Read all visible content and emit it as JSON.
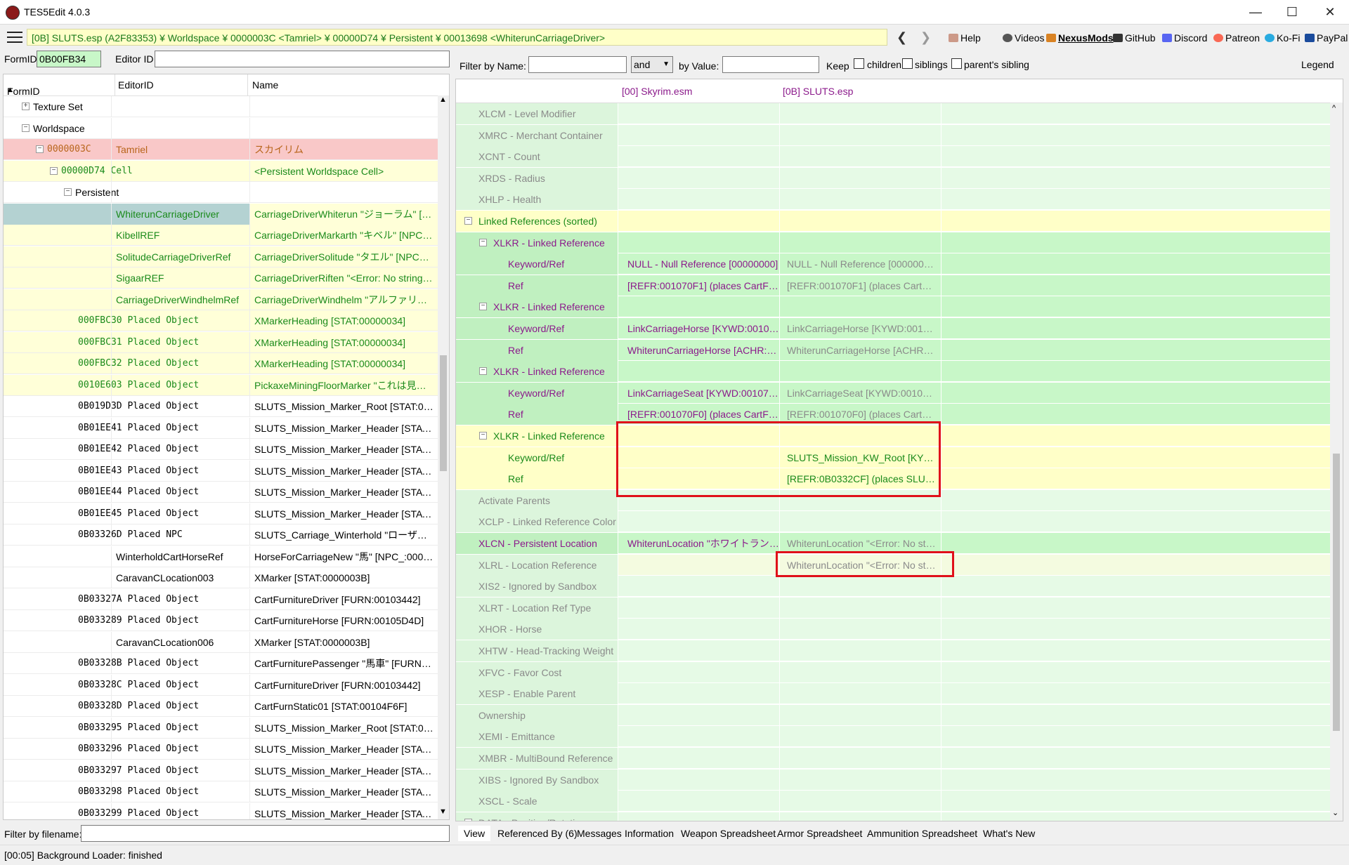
{
  "window": {
    "title": "TES5Edit 4.0.3"
  },
  "toolbar": {
    "path": "[0B] SLUTS.esp (A2F83353) ¥ Worldspace ¥ 0000003C <Tamriel> ¥ 00000D74 ¥ Persistent ¥ 00013698 <WhiterunCarriageDriver>",
    "links": [
      "Help",
      "Videos",
      "NexusMods",
      "GitHub",
      "Discord",
      "Patreon",
      "Ko-Fi",
      "PayPal"
    ]
  },
  "left": {
    "formid_label": "FormID",
    "formid_value": "0B00FB34",
    "editorid_label": "Editor ID",
    "editorid_value": "",
    "columns": [
      "FormID",
      "EditorID",
      "Name"
    ],
    "rows": [
      {
        "indent": 0,
        "toggle": "+",
        "c1": "Texture Set",
        "c2": "",
        "c3": "",
        "style": "plain"
      },
      {
        "indent": 0,
        "toggle": "-",
        "c1": "Worldspace",
        "c2": "",
        "c3": "",
        "style": "plain"
      },
      {
        "indent": 1,
        "toggle": "-",
        "c1": "0000003C",
        "c2": "Tamriel",
        "c3": "スカイリム",
        "style": "pink"
      },
      {
        "indent": 2,
        "toggle": "-",
        "c1": "00000D74  Cell",
        "c2": "",
        "c3": "<Persistent Worldspace Cell>",
        "style": "yellowgreen"
      },
      {
        "indent": 3,
        "toggle": "-",
        "c1": "Persistent",
        "c2": "",
        "c3": "",
        "style": "plain"
      },
      {
        "indent": 4,
        "toggle": "",
        "c1": "",
        "c2": "WhiterunCarriageDriver",
        "c3": "CarriageDriverWhiterun \"ジョーラム\" [NPC_...",
        "style": "selected"
      },
      {
        "indent": 4,
        "toggle": "",
        "c1": "",
        "c2": "KibellREF",
        "c3": "CarriageDriverMarkarth \"キベル\" [NPC_:00...",
        "style": "yg"
      },
      {
        "indent": 4,
        "toggle": "",
        "c1": "",
        "c2": "SolitudeCarriageDriverRef",
        "c3": "CarriageDriverSolitude \"タエル\" [NPC_:00...",
        "style": "yg"
      },
      {
        "indent": 4,
        "toggle": "",
        "c1": "",
        "c2": "SigaarREF",
        "c3": "CarriageDriverRiften \"<Error: No strings ...",
        "style": "yg"
      },
      {
        "indent": 4,
        "toggle": "",
        "c1": "",
        "c2": "CarriageDriverWindhelmRef",
        "c3": "CarriageDriverWindhelm \"アルファリン\" [N...",
        "style": "yg"
      },
      {
        "indent": 4,
        "toggle": "",
        "c1": "000FBC30  Placed Object",
        "c2": "",
        "c3": "XMarkerHeading [STAT:00000034]",
        "style": "yg"
      },
      {
        "indent": 4,
        "toggle": "",
        "c1": "000FBC31  Placed Object",
        "c2": "",
        "c3": "XMarkerHeading [STAT:00000034]",
        "style": "yg"
      },
      {
        "indent": 4,
        "toggle": "",
        "c1": "000FBC32  Placed Object",
        "c2": "",
        "c3": "XMarkerHeading [STAT:00000034]",
        "style": "yg"
      },
      {
        "indent": 4,
        "toggle": "",
        "c1": "0010E603  Placed Object",
        "c2": "",
        "c3": "PickaxeMiningFloorMarker \"これは見えて...",
        "style": "yg"
      },
      {
        "indent": 4,
        "toggle": "",
        "c1": "0B019D3D  Placed Object",
        "c2": "",
        "c3": "SLUTS_Mission_Marker_Root [STAT:0B01...",
        "style": "plain"
      },
      {
        "indent": 4,
        "toggle": "",
        "c1": "0B01EE41  Placed Object",
        "c2": "",
        "c3": "SLUTS_Mission_Marker_Header [STAT:0B...",
        "style": "plain"
      },
      {
        "indent": 4,
        "toggle": "",
        "c1": "0B01EE42  Placed Object",
        "c2": "",
        "c3": "SLUTS_Mission_Marker_Header [STAT:0B...",
        "style": "plain"
      },
      {
        "indent": 4,
        "toggle": "",
        "c1": "0B01EE43  Placed Object",
        "c2": "",
        "c3": "SLUTS_Mission_Marker_Header [STAT:0B...",
        "style": "plain"
      },
      {
        "indent": 4,
        "toggle": "",
        "c1": "0B01EE44  Placed Object",
        "c2": "",
        "c3": "SLUTS_Mission_Marker_Header [STAT:0B...",
        "style": "plain"
      },
      {
        "indent": 4,
        "toggle": "",
        "c1": "0B01EE45  Placed Object",
        "c2": "",
        "c3": "SLUTS_Mission_Marker_Header [STAT:0B...",
        "style": "plain"
      },
      {
        "indent": 4,
        "toggle": "",
        "c1": "0B03326D  Placed NPC",
        "c2": "",
        "c3": "SLUTS_Carriage_Winterhold \"ローザー・スノ...",
        "style": "plain"
      },
      {
        "indent": 4,
        "toggle": "",
        "c1": "",
        "c2": "WinterholdCartHorseRef",
        "c3": "HorseForCarriageNew \"馬\" [NPC_:00072...",
        "style": "plain"
      },
      {
        "indent": 4,
        "toggle": "",
        "c1": "",
        "c2": "CaravanCLocation003",
        "c3": "XMarker [STAT:0000003B]",
        "style": "plain"
      },
      {
        "indent": 4,
        "toggle": "",
        "c1": "0B03327A  Placed Object",
        "c2": "",
        "c3": "CartFurnitureDriver [FURN:00103442]",
        "style": "plain"
      },
      {
        "indent": 4,
        "toggle": "",
        "c1": "0B033289  Placed Object",
        "c2": "",
        "c3": "CartFurnitureHorse [FURN:00105D4D]",
        "style": "plain"
      },
      {
        "indent": 4,
        "toggle": "",
        "c1": "",
        "c2": "CaravanCLocation006",
        "c3": "XMarker [STAT:0000003B]",
        "style": "plain"
      },
      {
        "indent": 4,
        "toggle": "",
        "c1": "0B03328B  Placed Object",
        "c2": "",
        "c3": "CartFurniturePassenger \"馬車\" [FURN:00...",
        "style": "plain"
      },
      {
        "indent": 4,
        "toggle": "",
        "c1": "0B03328C  Placed Object",
        "c2": "",
        "c3": "CartFurnitureDriver [FURN:00103442]",
        "style": "plain"
      },
      {
        "indent": 4,
        "toggle": "",
        "c1": "0B03328D  Placed Object",
        "c2": "",
        "c3": "CartFurnStatic01 [STAT:00104F6F]",
        "style": "plain"
      },
      {
        "indent": 4,
        "toggle": "",
        "c1": "0B033295  Placed Object",
        "c2": "",
        "c3": "SLUTS_Mission_Marker_Root [STAT:0B01...",
        "style": "plain"
      },
      {
        "indent": 4,
        "toggle": "",
        "c1": "0B033296  Placed Object",
        "c2": "",
        "c3": "SLUTS_Mission_Marker_Header [STAT:0B...",
        "style": "plain"
      },
      {
        "indent": 4,
        "toggle": "",
        "c1": "0B033297  Placed Object",
        "c2": "",
        "c3": "SLUTS_Mission_Marker_Header [STAT:0B...",
        "style": "plain"
      },
      {
        "indent": 4,
        "toggle": "",
        "c1": "0B033298  Placed Object",
        "c2": "",
        "c3": "SLUTS_Mission_Marker_Header [STAT:0B...",
        "style": "plain"
      },
      {
        "indent": 4,
        "toggle": "",
        "c1": "0B033299  Placed Object",
        "c2": "",
        "c3": "SLUTS_Mission_Marker_Header [STAT:0B...",
        "style": "plain"
      }
    ],
    "filter_label": "Filter by filename:",
    "filter_value": ""
  },
  "right": {
    "filter_name_label": "Filter by Name:",
    "filter_name_value": "",
    "op_value": "and",
    "filter_value_label": "by Value:",
    "filter_value_value": "",
    "keep_label": "Keep",
    "keep_children": "children",
    "keep_siblings": "siblings",
    "keep_parents_sibling": "parent's sibling",
    "legend": "Legend",
    "col1": "[00] Skyrim.esm",
    "col2": "[0B] SLUTS.esp",
    "rows": [
      {
        "level": 0,
        "toggle": "",
        "label": "XLCM - Level Modifier",
        "v1": "",
        "v2": "",
        "style": "dim"
      },
      {
        "level": 0,
        "toggle": "",
        "label": "XMRC - Merchant Container",
        "v1": "",
        "v2": "",
        "style": "dim"
      },
      {
        "level": 0,
        "toggle": "",
        "label": "XCNT - Count",
        "v1": "",
        "v2": "",
        "style": "dim"
      },
      {
        "level": 0,
        "toggle": "",
        "label": "XRDS - Radius",
        "v1": "",
        "v2": "",
        "style": "dim"
      },
      {
        "level": 0,
        "toggle": "",
        "label": "XHLP - Health",
        "v1": "",
        "v2": "",
        "style": "dim"
      },
      {
        "level": 0,
        "toggle": "-",
        "label": "Linked References (sorted)",
        "v1": "",
        "v2": "",
        "style": "yellow"
      },
      {
        "level": 1,
        "toggle": "-",
        "label": "XLKR - Linked Reference",
        "v1": "",
        "v2": "",
        "style": "green"
      },
      {
        "level": 2,
        "toggle": "",
        "label": "Keyword/Ref",
        "v1": "NULL - Null Reference [00000000]",
        "v2": "NULL - Null Reference [00000000]",
        "style": "green"
      },
      {
        "level": 2,
        "toggle": "",
        "label": "Ref",
        "v1": "[REFR:001070F1] (places CartFurn...",
        "v2": "[REFR:001070F1] (places CartFurn...",
        "style": "green"
      },
      {
        "level": 1,
        "toggle": "-",
        "label": "XLKR - Linked Reference",
        "v1": "",
        "v2": "",
        "style": "green"
      },
      {
        "level": 2,
        "toggle": "",
        "label": "Keyword/Ref",
        "v1": "LinkCarriageHorse [KYWD:00107...",
        "v2": "LinkCarriageHorse [KYWD:00107...",
        "style": "green"
      },
      {
        "level": 2,
        "toggle": "",
        "label": "Ref",
        "v1": "WhiterunCarriageHorse [ACHR:00...",
        "v2": "WhiterunCarriageHorse [ACHR:00...",
        "style": "green"
      },
      {
        "level": 1,
        "toggle": "-",
        "label": "XLKR - Linked Reference",
        "v1": "",
        "v2": "",
        "style": "green"
      },
      {
        "level": 2,
        "toggle": "",
        "label": "Keyword/Ref",
        "v1": "LinkCarriageSeat [KYWD:0010770...",
        "v2": "LinkCarriageSeat [KYWD:0010770...",
        "style": "green"
      },
      {
        "level": 2,
        "toggle": "",
        "label": "Ref",
        "v1": "[REFR:001070F0] (places CartFurn...",
        "v2": "[REFR:001070F0] (places CartFurn...",
        "style": "green"
      },
      {
        "level": 1,
        "toggle": "-",
        "label": "XLKR - Linked Reference",
        "v1": "",
        "v2": "",
        "style": "yellow"
      },
      {
        "level": 2,
        "toggle": "",
        "label": "Keyword/Ref",
        "v1": "",
        "v2": "SLUTS_Mission_KW_Root [KYWD:...",
        "style": "yellow"
      },
      {
        "level": 2,
        "toggle": "",
        "label": "Ref",
        "v1": "",
        "v2": "[REFR:0B0332CF] (places SLUTS_...",
        "style": "yellow"
      },
      {
        "level": 0,
        "toggle": "",
        "label": "Activate Parents",
        "v1": "",
        "v2": "",
        "style": "dim"
      },
      {
        "level": 0,
        "toggle": "",
        "label": "XCLP - Linked Reference Color",
        "v1": "",
        "v2": "",
        "style": "dim"
      },
      {
        "level": 0,
        "toggle": "",
        "label": "XLCN - Persistent Location",
        "v1": "WhiterunLocation \"ホワイトラン\" [LC...",
        "v2": "WhiterunLocation \"<Error: No stri...",
        "style": "purple"
      },
      {
        "level": 0,
        "toggle": "",
        "label": "XLRL - Location Reference",
        "v1": "",
        "v2": "WhiterunLocation \"<Error: No stri...",
        "style": "lightyellow"
      },
      {
        "level": 0,
        "toggle": "",
        "label": "XIS2 - Ignored by Sandbox",
        "v1": "",
        "v2": "",
        "style": "dim"
      },
      {
        "level": 0,
        "toggle": "",
        "label": "XLRT - Location Ref Type",
        "v1": "",
        "v2": "",
        "style": "dim"
      },
      {
        "level": 0,
        "toggle": "",
        "label": "XHOR - Horse",
        "v1": "",
        "v2": "",
        "style": "dim"
      },
      {
        "level": 0,
        "toggle": "",
        "label": "XHTW - Head-Tracking Weight",
        "v1": "",
        "v2": "",
        "style": "dim"
      },
      {
        "level": 0,
        "toggle": "",
        "label": "XFVC - Favor Cost",
        "v1": "",
        "v2": "",
        "style": "dim"
      },
      {
        "level": 0,
        "toggle": "",
        "label": "XESP - Enable Parent",
        "v1": "",
        "v2": "",
        "style": "dim"
      },
      {
        "level": 0,
        "toggle": "",
        "label": "Ownership",
        "v1": "",
        "v2": "",
        "style": "dim"
      },
      {
        "level": 0,
        "toggle": "",
        "label": "XEMI - Emittance",
        "v1": "",
        "v2": "",
        "style": "dim"
      },
      {
        "level": 0,
        "toggle": "",
        "label": "XMBR - MultiBound Reference",
        "v1": "",
        "v2": "",
        "style": "dim"
      },
      {
        "level": 0,
        "toggle": "",
        "label": "XIBS - Ignored By Sandbox",
        "v1": "",
        "v2": "",
        "style": "dim"
      },
      {
        "level": 0,
        "toggle": "",
        "label": "XSCL - Scale",
        "v1": "",
        "v2": "",
        "style": "dim"
      },
      {
        "level": 0,
        "toggle": "-",
        "label": "DATA - Position/Rotation",
        "v1": "",
        "v2": "",
        "style": "dim"
      }
    ]
  },
  "tabs": [
    "View",
    "Referenced By (6)",
    "Messages",
    "Information",
    "Weapon Spreadsheet",
    "Armor Spreadsheet",
    "Ammunition Spreadsheet",
    "What's New"
  ],
  "status": "[00:05] Background Loader: finished",
  "colors": {
    "pink": "#f9c8c8",
    "yellow": "#ffffc8",
    "green": "#c8f7c8",
    "lightgreen": "#e6fae6",
    "selected": "#b4d2d2",
    "highlight": "#e0101a",
    "purple": "#8b1a8b"
  }
}
